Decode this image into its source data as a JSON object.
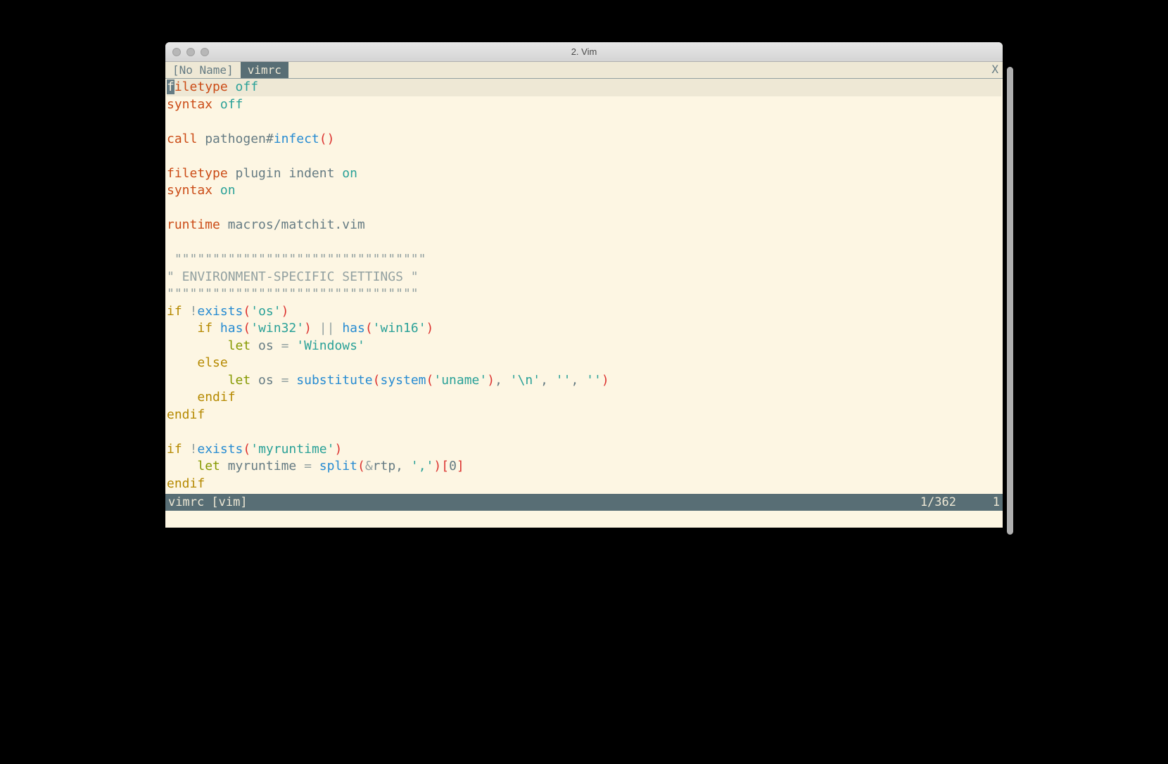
{
  "window": {
    "title": "2. Vim"
  },
  "tabs": {
    "items": [
      {
        "label": "[No Name]"
      },
      {
        "label": "vimrc"
      }
    ],
    "close_label": "X"
  },
  "code": {
    "l1": {
      "kw": "filetype",
      "opt": "off"
    },
    "l2": {
      "kw": "syntax",
      "opt": "off"
    },
    "l4": {
      "kw": "call",
      "id": "pathogen#",
      "fn": "infect",
      "p1": "(",
      "p2": ")"
    },
    "l6": {
      "kw": "filetype",
      "mid": "plugin indent",
      "opt": "on"
    },
    "l7": {
      "kw": "syntax",
      "opt": "on"
    },
    "l9": {
      "kw": "runtime",
      "path": "macros/matchit.vim"
    },
    "l11": "\"\"\"\"\"\"\"\"\"\"\"\"\"\"\"\"\"\"\"\"\"\"\"\"\"\"\"\"\"\"\"\"\"",
    "l12": "\" ENVIRONMENT-SPECIFIC SETTINGS \"",
    "l13": "\"\"\"\"\"\"\"\"\"\"\"\"\"\"\"\"\"\"\"\"\"\"\"\"\"\"\"\"\"\"\"\"\"",
    "l14": {
      "if": "if",
      "neg": "!",
      "fn": "exists",
      "p1": "(",
      "s": "'os'",
      "p2": ")"
    },
    "l15": {
      "if": "if",
      "fn1": "has",
      "p1": "(",
      "s1": "'win32'",
      "p2": ")",
      "op": " || ",
      "fn2": "has",
      "p3": "(",
      "s2": "'win16'",
      "p4": ")"
    },
    "l16": {
      "let": "let",
      "var": " os ",
      "eq": "=",
      "s": " 'Windows'"
    },
    "l17": "else",
    "l18": {
      "let": "let",
      "var": " os ",
      "eq": "=",
      "fn1": "substitute",
      "p1": "(",
      "fn2": "system",
      "p2": "(",
      "s1": "'uname'",
      "p3": ")",
      "c1": ",",
      "s2": " '\\n'",
      "c2": ",",
      "s3": " ''",
      "c3": ",",
      "s4": " ''",
      "p4": ")"
    },
    "l19": "endif",
    "l20": "endif",
    "l22": {
      "if": "if",
      "neg": "!",
      "fn": "exists",
      "p1": "(",
      "s": "'myruntime'",
      "p2": ")"
    },
    "l23": {
      "let": "let",
      "var": " myruntime ",
      "eq": "=",
      "fn": " split",
      "p1": "(",
      "amp": "&",
      "id": "rtp",
      "c": ",",
      "s": " ','",
      "p2": ")",
      "br1": "[",
      "n": "0",
      "br2": "]"
    },
    "l24": "endif"
  },
  "status": {
    "file": " vimrc [vim]",
    "pos": "1/362",
    "col": "1"
  }
}
